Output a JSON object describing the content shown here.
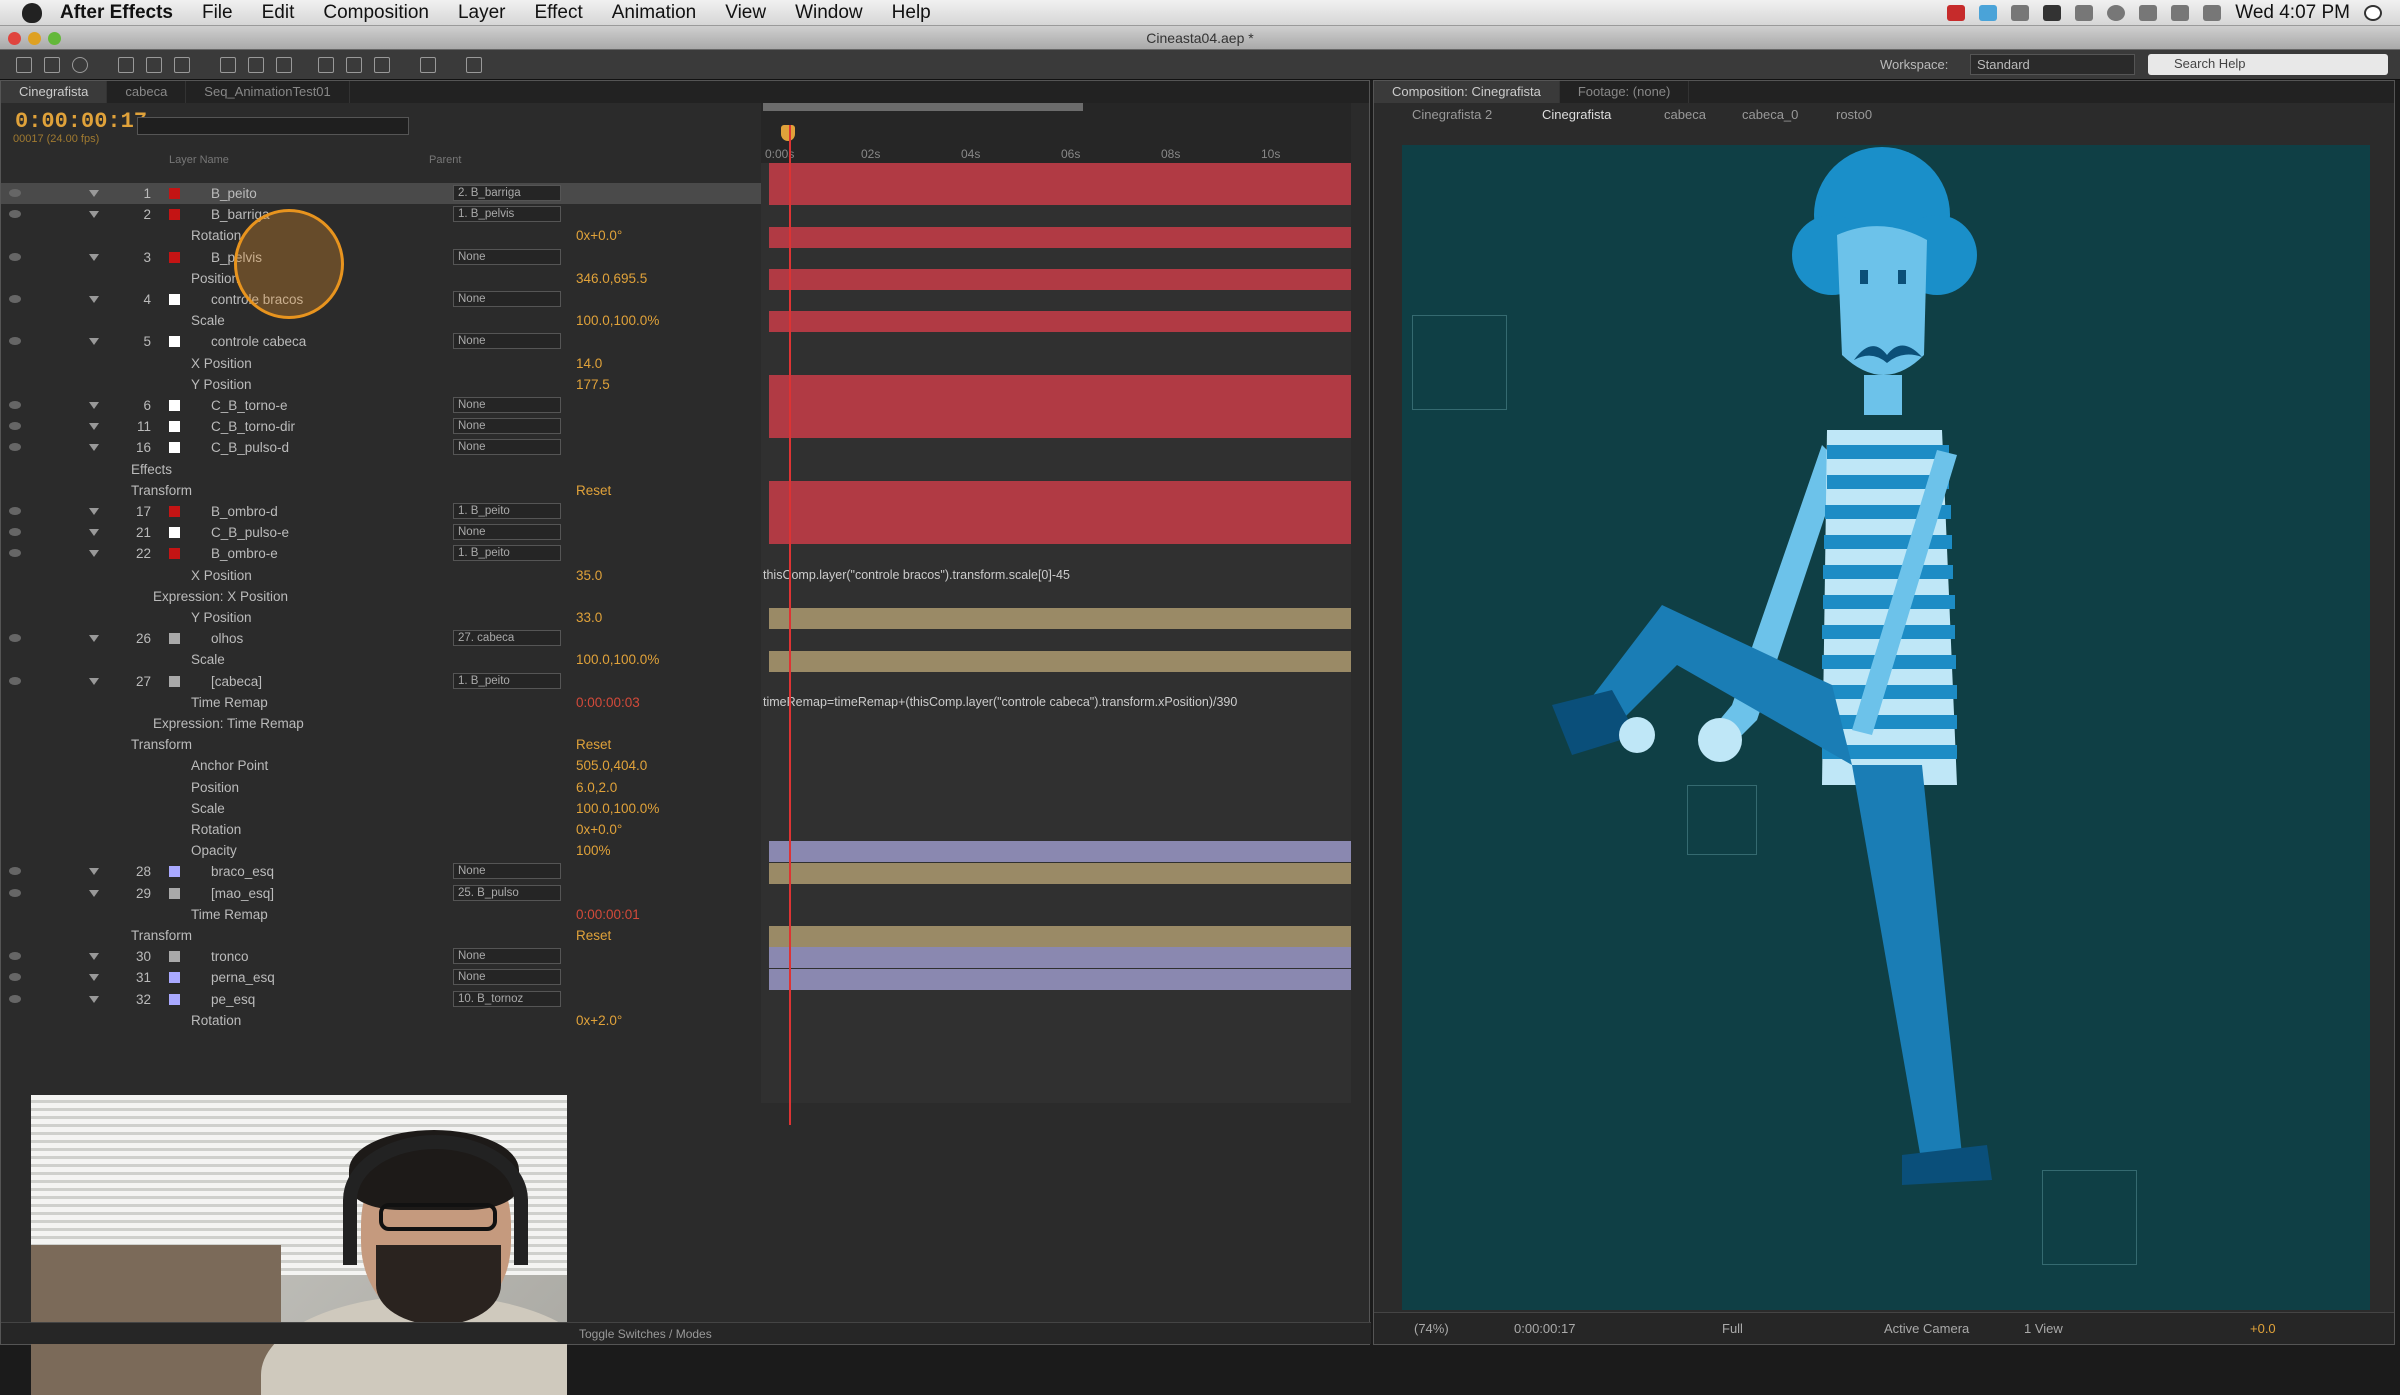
{
  "menubar": {
    "app": "After Effects",
    "items": [
      "File",
      "Edit",
      "Composition",
      "Layer",
      "Effect",
      "Animation",
      "View",
      "Window",
      "Help"
    ],
    "clock": "Wed 4:07 PM"
  },
  "window": {
    "title": "Cineasta04.aep *"
  },
  "toolbar": {
    "workspace_label": "Workspace:",
    "workspace_value": "Standard",
    "search_placeholder": "Search Help"
  },
  "timeline": {
    "tabs": [
      "Cinegrafista",
      "cabeca",
      "Seq_AnimationTest01"
    ],
    "timecode": "0:00:00:17",
    "fps": "00017 (24.00 fps)",
    "col_layer_name": "Layer Name",
    "col_parent": "Parent",
    "ruler": [
      "0:00s",
      "02s",
      "04s",
      "06s",
      "08s",
      "10s"
    ],
    "footer": "Toggle Switches / Modes",
    "layers": [
      {
        "num": "1",
        "name": "B_peito",
        "color": "#c41414",
        "parent": "2. B_barriga",
        "kind": "layer",
        "sel": true,
        "bar": "#b13a44"
      },
      {
        "num": "2",
        "name": "B_barriga",
        "color": "#c41414",
        "parent": "1. B_pelvis",
        "kind": "layer",
        "bar": "#b13a44"
      },
      {
        "prop": "Rotation",
        "val": "0x+0.0°",
        "kind": "prop"
      },
      {
        "num": "3",
        "name": "B_pelvis",
        "color": "#c41414",
        "parent": "None",
        "kind": "layer",
        "bar": "#b13a44"
      },
      {
        "prop": "Position",
        "val": "346.0,695.5",
        "kind": "prop"
      },
      {
        "num": "4",
        "name": "controle bracos",
        "color": "#ffffff",
        "parent": "None",
        "kind": "layer",
        "bar": "#b13a44"
      },
      {
        "prop": "Scale",
        "val": "100.0,100.0%",
        "kind": "prop"
      },
      {
        "num": "5",
        "name": "controle cabeca",
        "color": "#ffffff",
        "parent": "None",
        "kind": "layer",
        "bar": "#b13a44"
      },
      {
        "prop": "X Position",
        "val": "14.0",
        "kind": "prop"
      },
      {
        "prop": "Y Position",
        "val": "177.5",
        "kind": "prop"
      },
      {
        "num": "6",
        "name": "C_B_torno-e",
        "color": "#ffffff",
        "parent": "None",
        "kind": "layer",
        "bar": "#b13a44"
      },
      {
        "num": "11",
        "name": "C_B_torno-dir",
        "color": "#ffffff",
        "parent": "None",
        "kind": "layer",
        "bar": "#b13a44"
      },
      {
        "num": "16",
        "name": "C_B_pulso-d",
        "color": "#ffffff",
        "parent": "None",
        "kind": "layer",
        "bar": "#b13a44"
      },
      {
        "prop": "Effects",
        "val": "",
        "kind": "group"
      },
      {
        "prop": "Transform",
        "val": "Reset",
        "kind": "group"
      },
      {
        "num": "17",
        "name": "B_ombro-d",
        "color": "#c41414",
        "parent": "1. B_peito",
        "kind": "layer",
        "bar": "#b13a44"
      },
      {
        "num": "21",
        "name": "C_B_pulso-e",
        "color": "#ffffff",
        "parent": "None",
        "kind": "layer",
        "bar": "#b13a44"
      },
      {
        "num": "22",
        "name": "B_ombro-e",
        "color": "#c41414",
        "parent": "1. B_peito",
        "kind": "layer",
        "bar": "#b13a44"
      },
      {
        "prop": "X Position",
        "val": "35.0",
        "kind": "prop"
      },
      {
        "prop": "Expression: X Position",
        "val": "",
        "kind": "expr",
        "expr": "thisComp.layer(\"controle bracos\").transform.scale[0]-45"
      },
      {
        "prop": "Y Position",
        "val": "33.0",
        "kind": "prop"
      },
      {
        "num": "26",
        "name": "olhos",
        "color": "#a9a9a9",
        "parent": "27. cabeca",
        "kind": "layer",
        "bar": "#9a8a66"
      },
      {
        "prop": "Scale",
        "val": "100.0,100.0%",
        "kind": "prop"
      },
      {
        "num": "27",
        "name": "[cabeca]",
        "color": "#a9a9a9",
        "parent": "1. B_peito",
        "kind": "layer",
        "bar": "#9a8a66"
      },
      {
        "prop": "Time Remap",
        "val": "0:00:00:03",
        "kind": "prop",
        "red": true
      },
      {
        "prop": "Expression: Time Remap",
        "val": "",
        "kind": "expr",
        "expr": "timeRemap=timeRemap+(thisComp.layer(\"controle cabeca\").transform.xPosition)/390"
      },
      {
        "prop": "Transform",
        "val": "Reset",
        "kind": "group"
      },
      {
        "prop": "Anchor Point",
        "val": "505.0,404.0",
        "kind": "prop"
      },
      {
        "prop": "Position",
        "val": "6.0,2.0",
        "kind": "prop"
      },
      {
        "prop": "Scale",
        "val": "100.0,100.0%",
        "kind": "prop"
      },
      {
        "prop": "Rotation",
        "val": "0x+0.0°",
        "kind": "prop"
      },
      {
        "prop": "Opacity",
        "val": "100%",
        "kind": "prop"
      },
      {
        "num": "28",
        "name": "braco_esq",
        "color": "#a9a9ff",
        "parent": "None",
        "kind": "layer",
        "bar": "#8a88b0"
      },
      {
        "num": "29",
        "name": "[mao_esq]",
        "color": "#a9a9a9",
        "parent": "25. B_pulso",
        "kind": "layer",
        "bar": "#9a8a66"
      },
      {
        "prop": "Time Remap",
        "val": "0:00:00:01",
        "kind": "prop",
        "red": true
      },
      {
        "prop": "Transform",
        "val": "Reset",
        "kind": "group"
      },
      {
        "num": "30",
        "name": "tronco",
        "color": "#a9a9a9",
        "parent": "None",
        "kind": "layer",
        "bar": "#9a8a66"
      },
      {
        "num": "31",
        "name": "perna_esq",
        "color": "#a9a9ff",
        "parent": "None",
        "kind": "layer",
        "bar": "#8a88b0"
      },
      {
        "num": "32",
        "name": "pe_esq",
        "color": "#a9a9ff",
        "parent": "10. B_tornoz",
        "kind": "layer",
        "bar": "#8a88b0"
      },
      {
        "prop": "Rotation",
        "val": "0x+2.0°",
        "kind": "prop"
      }
    ]
  },
  "composition": {
    "tab": "Composition: Cinegrafista",
    "footage": "Footage: (none)",
    "breadcrumb": [
      "Cinegrafista 2",
      "Cinegrafista",
      "cabeca",
      "cabeca_0",
      "rosto0"
    ],
    "bg_color": "#0f3f45",
    "footer": {
      "zoom": "(74%)",
      "timecode": "0:00:00:17",
      "resolution": "Full",
      "camera": "Active Camera",
      "view": "1 View",
      "exposure": "+0.0"
    }
  }
}
